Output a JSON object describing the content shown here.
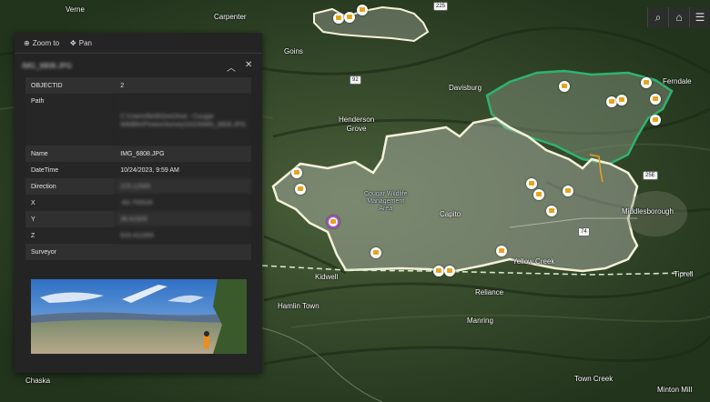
{
  "map": {
    "places": [
      {
        "id": "verne",
        "name": "Verne"
      },
      {
        "id": "carpenter",
        "name": "Carpenter"
      },
      {
        "id": "goins",
        "name": "Goins"
      },
      {
        "id": "ferndale",
        "name": "Ferndale"
      },
      {
        "id": "davisburg",
        "name": "Davisburg"
      },
      {
        "id": "henderson-grove",
        "name": "Henderson\nGrove"
      },
      {
        "id": "capito",
        "name": "Capito"
      },
      {
        "id": "middlesborough",
        "name": "Middlesborough"
      },
      {
        "id": "yellow-creek",
        "name": "Yellow Creek"
      },
      {
        "id": "kidwell",
        "name": "Kidwell"
      },
      {
        "id": "reliance",
        "name": "Reliance"
      },
      {
        "id": "hamlin-town",
        "name": "Hamlin Town"
      },
      {
        "id": "manring",
        "name": "Manring"
      },
      {
        "id": "tiprell",
        "name": "Tiprell"
      },
      {
        "id": "chaska",
        "name": "Chaska"
      },
      {
        "id": "town-creek",
        "name": "Town Creek"
      },
      {
        "id": "minton-mill",
        "name": "Minton Mill"
      }
    ],
    "area_label": "Cougar Wildlife\nManagement\nArea",
    "highways": [
      "225",
      "92",
      "74",
      "25E"
    ]
  },
  "toolbar": {
    "icons": [
      "search-icon",
      "home-icon",
      "layer-list-icon"
    ],
    "search_glyph": "⌕",
    "home_glyph": "⌂",
    "list_glyph": "☰"
  },
  "popup": {
    "zoom_label": "Zoom to",
    "pan_label": "Pan",
    "zoom_glyph": "⊕",
    "pan_glyph": "✥",
    "title": "IMG_6808.JPG",
    "collapse_glyph": "︿",
    "close_glyph": "✕",
    "fields": [
      {
        "key": "OBJECTID",
        "value": "2",
        "blurred": false
      },
      {
        "key": "Path",
        "value": "C:\\Users\\field\\OneDrive - Cougar Wildlife\\Photos\\Survey\\2023\\IMG_6808.JPG",
        "blurred": true
      },
      {
        "key": "Name",
        "value": "IMG_6808.JPG",
        "blurred": false
      },
      {
        "key": "DateTime",
        "value": "10/24/2023, 9:59 AM",
        "blurred": false
      },
      {
        "key": "Direction",
        "value": "215.12565",
        "blurred": true
      },
      {
        "key": "X",
        "value": "-83.755526",
        "blurred": true
      },
      {
        "key": "Y",
        "value": "36.61509",
        "blurred": true
      },
      {
        "key": "Z",
        "value": "633.411955",
        "blurred": true
      },
      {
        "key": "Surveyor",
        "value": "",
        "blurred": false
      }
    ]
  },
  "colors": {
    "burn_outline": "#f4f2d9",
    "green_outline": "#2fb36e",
    "dashed_boundary": "#cfe9c9",
    "marker_fill": "#e8a21c",
    "selected_ring": "#b14fd0",
    "orange_road": "#e8a21c"
  }
}
